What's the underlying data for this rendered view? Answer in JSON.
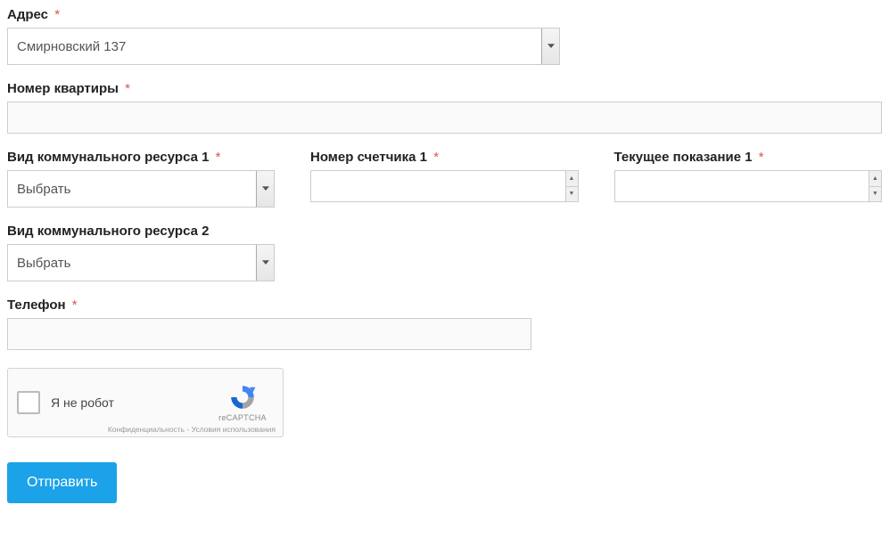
{
  "form": {
    "address": {
      "label": "Адрес",
      "required": "*",
      "value": "Смирновский 137"
    },
    "apartment": {
      "label": "Номер квартиры",
      "required": "*",
      "value": ""
    },
    "resource1_type": {
      "label": "Вид коммунального ресурса 1",
      "required": "*",
      "value": "Выбрать"
    },
    "meter1": {
      "label": "Номер счетчика 1",
      "required": "*",
      "value": ""
    },
    "reading1": {
      "label": "Текущее показание 1",
      "required": "*",
      "value": ""
    },
    "resource2_type": {
      "label": "Вид коммунального ресурса 2",
      "value": "Выбрать"
    },
    "phone": {
      "label": "Телефон",
      "required": "*",
      "value": ""
    }
  },
  "captcha": {
    "label": "Я не робот",
    "brand": "reCAPTCHA",
    "legal_privacy": "Конфиденциальность",
    "legal_sep": " - ",
    "legal_terms": "Условия использования"
  },
  "submit": {
    "label": "Отправить"
  }
}
